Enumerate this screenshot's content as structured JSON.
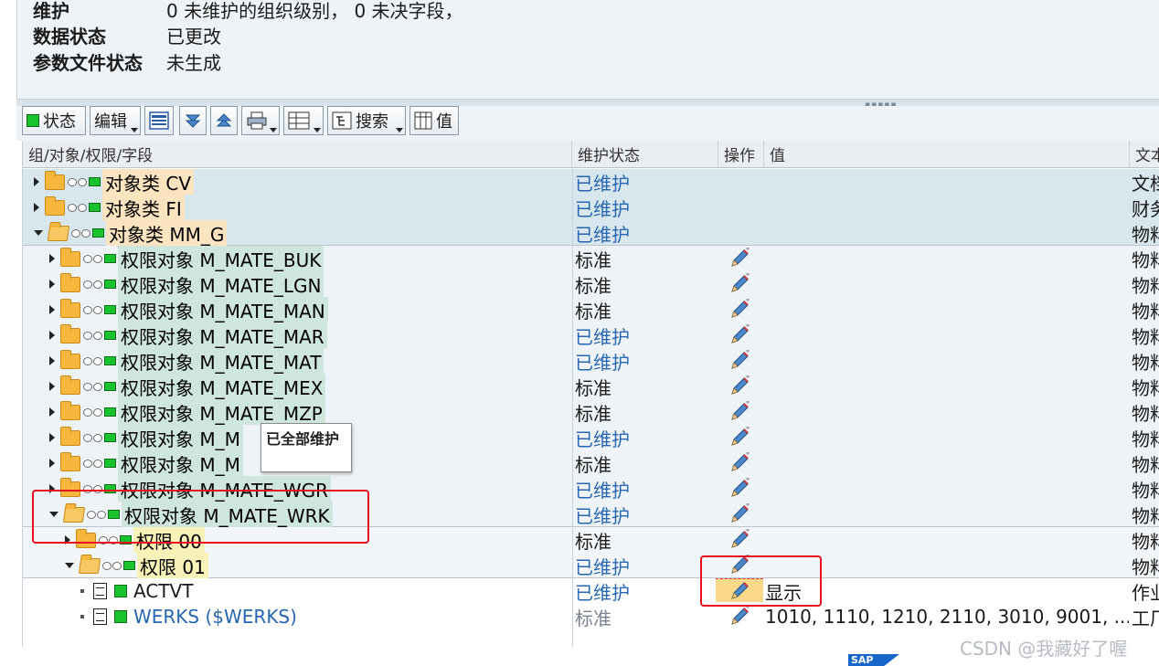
{
  "header": {
    "rows": [
      {
        "label": "维护",
        "value": "0 未维护的组织级别， 0 未决字段，"
      },
      {
        "label": "数据状态",
        "value": "已更改"
      },
      {
        "label": "参数文件状态",
        "value": "未生成"
      }
    ]
  },
  "toolbar": {
    "status_label": "状态",
    "edit_label": "编辑",
    "search_label": "搜索",
    "value_label": "值"
  },
  "columns": {
    "tree": "组/对象/权限/字段",
    "maint_status": "维护状态",
    "action": "操作",
    "value": "值",
    "text": "文本"
  },
  "rows": [
    {
      "prefix": "对象类",
      "name": "CV",
      "status": "已维护",
      "value": "",
      "text": "文档"
    },
    {
      "prefix": "对象类",
      "name": "FI",
      "status": "已维护",
      "value": "",
      "text": "财务"
    },
    {
      "prefix": "对象类",
      "name": "MM_G",
      "status": "已维护",
      "value": "",
      "text": "物料"
    },
    {
      "prefix": "权限对象",
      "name": "M_MATE_BUK",
      "status": "标准",
      "value": "",
      "text": "物料"
    },
    {
      "prefix": "权限对象",
      "name": "M_MATE_LGN",
      "status": "标准",
      "value": "",
      "text": "物料"
    },
    {
      "prefix": "权限对象",
      "name": "M_MATE_MAN",
      "status": "标准",
      "value": "",
      "text": "物料"
    },
    {
      "prefix": "权限对象",
      "name": "M_MATE_MAR",
      "status": "已维护",
      "value": "",
      "text": "物料"
    },
    {
      "prefix": "权限对象",
      "name": "M_MATE_MAT",
      "status": "已维护",
      "value": "",
      "text": "物料"
    },
    {
      "prefix": "权限对象",
      "name": "M_MATE_MEX",
      "status": "标准",
      "value": "",
      "text": "物料"
    },
    {
      "prefix": "权限对象",
      "name": "M_MATE_MZP",
      "status": "标准",
      "value": "",
      "text": "物料"
    },
    {
      "prefix": "权限对象",
      "name": "M_M",
      "status": "已维护",
      "value": "",
      "text": "物料"
    },
    {
      "prefix": "权限对象",
      "name": "M_M",
      "status": "标准",
      "value": "",
      "text": "物料"
    },
    {
      "prefix": "权限对象",
      "name": "M_MATE_WGR",
      "status": "已维护",
      "value": "",
      "text": "物料"
    },
    {
      "prefix": "权限对象",
      "name": "M_MATE_WRK",
      "status": "已维护",
      "value": "",
      "text": "物料"
    },
    {
      "prefix": "权限",
      "name": "00",
      "status": "标准",
      "value": "",
      "text": "物料"
    },
    {
      "prefix": "权限",
      "name": "01",
      "status": "已维护",
      "value": "",
      "text": "物料"
    },
    {
      "prefix": "",
      "name": "ACTVT",
      "status": "已维护",
      "value": "显示",
      "text": "作业"
    },
    {
      "prefix": "",
      "name": "WERKS ($WERKS)",
      "status": "标准",
      "value": "1010, 1110, 1210, 2110, 3010, 9001, ...",
      "text": "工厂"
    }
  ],
  "tooltip": "已全部维护",
  "sap_logo": "SAP",
  "watermark": "CSDN @我藏好了喔"
}
